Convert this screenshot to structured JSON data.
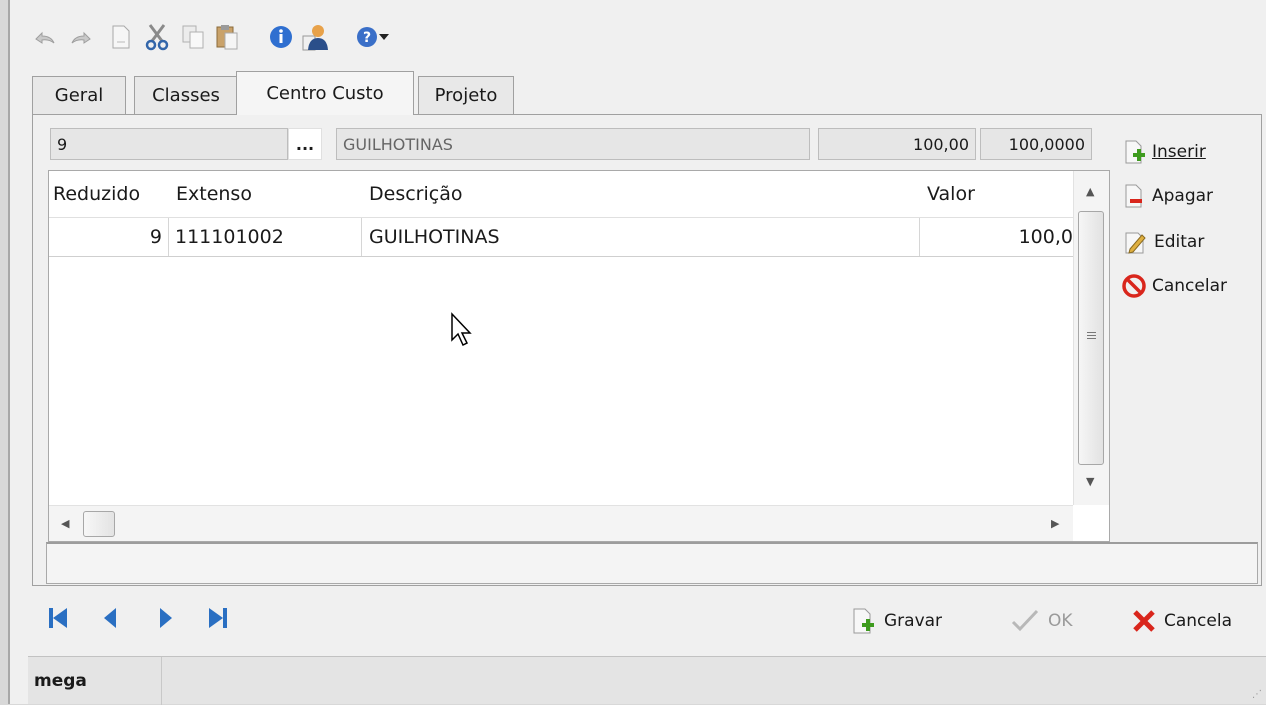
{
  "toolbar": {
    "icons": [
      "undo-icon",
      "redo-icon",
      "new-document-icon",
      "cut-icon",
      "copy-icon",
      "paste-icon",
      "info-icon",
      "user-icon",
      "help-icon",
      "dropdown-arrow-icon"
    ]
  },
  "tabs": [
    {
      "label": "Geral",
      "active": false
    },
    {
      "label": "Classes",
      "active": false
    },
    {
      "label": "Centro Custo",
      "active": true
    },
    {
      "label": "Projeto",
      "active": false
    }
  ],
  "fields": {
    "code": "9",
    "ellipsis": "...",
    "description": "GUILHOTINAS",
    "value": "100,00",
    "percent": "100,0000"
  },
  "grid": {
    "columns": [
      "Reduzido",
      "Extenso",
      "Descrição",
      "Valor"
    ],
    "rows": [
      {
        "reduzido": "9",
        "extenso": "111101002",
        "descricao": "GUILHOTINAS",
        "valor": "100,0"
      }
    ]
  },
  "side_buttons": {
    "insert": "Inserir",
    "delete": "Apagar",
    "edit": "Editar",
    "cancel": "Cancelar"
  },
  "actions": {
    "save": "Gravar",
    "ok": "OK",
    "cancel": "Cancela"
  },
  "status": {
    "user": "mega"
  },
  "colors": {
    "nav_blue": "#2a6fc2",
    "cancel_red": "#d9261c",
    "add_green": "#3e9b1e"
  }
}
